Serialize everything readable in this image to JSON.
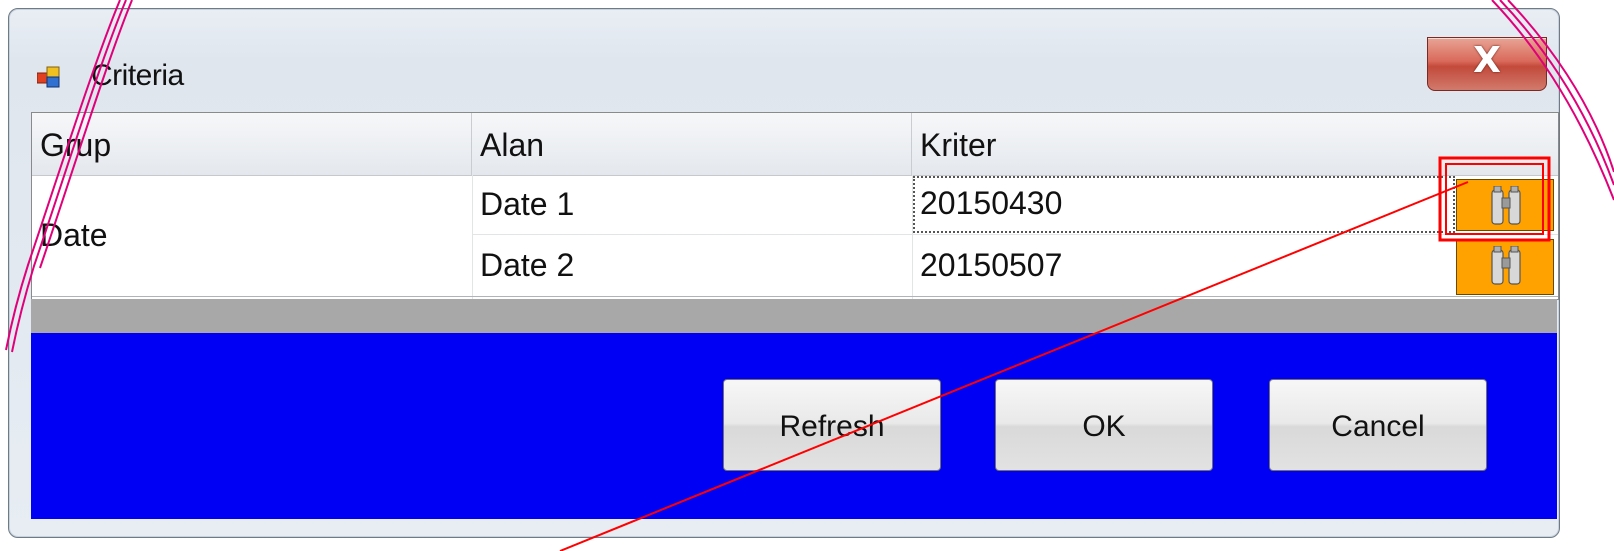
{
  "window": {
    "title": "Criteria",
    "close_label": "X",
    "icon": "app-window-icon"
  },
  "grid": {
    "columns": [
      "Grup",
      "Alan",
      "Kriter"
    ],
    "group": "Date",
    "rows": [
      {
        "alan": "Date 1",
        "kriter": "20150430",
        "button_icon": "binoculars-icon",
        "focused": true
      },
      {
        "alan": "Date 2",
        "kriter": "20150507",
        "button_icon": "binoculars-icon",
        "focused": false
      }
    ]
  },
  "buttons": {
    "refresh": "Refresh",
    "ok": "OK",
    "cancel": "Cancel"
  },
  "colors": {
    "panel_blue": "#0000f5",
    "band_gray": "#a8a8a8",
    "pick_button_orange": "#ffa200",
    "annotation_red": "#ff0000",
    "annotation_pink": "#e0007a"
  },
  "annotations": {
    "highlight_box": "binoculars button of row Date 1",
    "pointer_line": true,
    "decorative_curves": true
  }
}
